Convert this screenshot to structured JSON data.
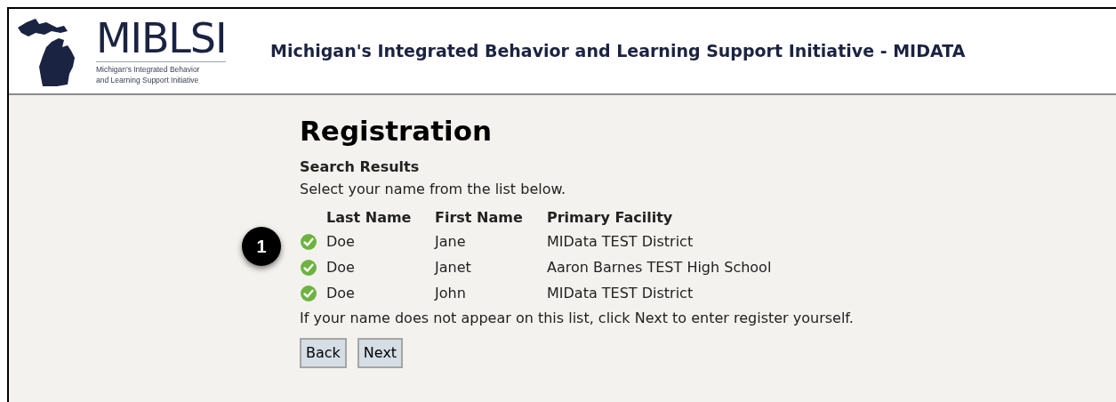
{
  "header": {
    "logo_text": "MIBLSI",
    "logo_subtitle": [
      "Michigan's Integrated Behavior",
      "and Learning Support Initiative"
    ],
    "title": "Michigan's Integrated Behavior and Learning Support Initiative - MIDATA"
  },
  "page": {
    "heading": "Registration",
    "subheading": "Search Results",
    "instruction": "Select your name from the list below.",
    "callout": "1",
    "table": {
      "columns": [
        "Last Name",
        "First Name",
        "Primary Facility"
      ],
      "rows": [
        {
          "cells": [
            "Doe",
            "Jane",
            "MIData TEST District"
          ]
        },
        {
          "cells": [
            "Doe",
            "Janet",
            "Aaron Barnes TEST High School"
          ]
        },
        {
          "cells": [
            "Doe",
            "John",
            "MIData TEST District"
          ]
        }
      ]
    },
    "note": "If your name does not appear on this list, click Next to enter register yourself.",
    "buttons": [
      "Back",
      "Next"
    ]
  }
}
